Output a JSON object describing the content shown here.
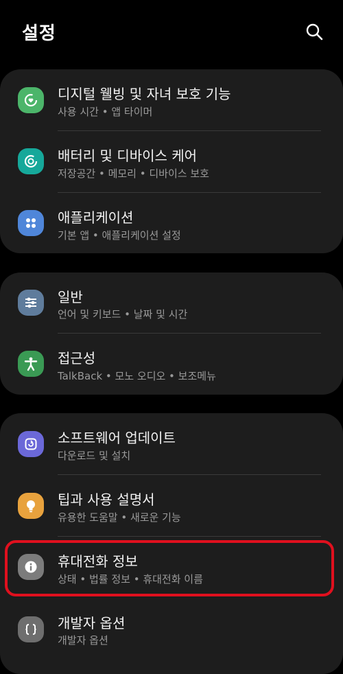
{
  "header": {
    "title": "설정",
    "search_icon": "search-icon"
  },
  "groups": [
    {
      "items": [
        {
          "title": "디지털 웰빙 및 자녀 보호 기능",
          "subtitle": "사용 시간 • 앱 타이머",
          "icon": "digital-wellbeing-icon",
          "color": "#4cb56a"
        },
        {
          "title": "배터리 및 디바이스 케어",
          "subtitle": "저장공간 • 메모리 • 디바이스 보호",
          "icon": "device-care-icon",
          "color": "#16a89a"
        },
        {
          "title": "애플리케이션",
          "subtitle": "기본 앱 • 애플리케이션 설정",
          "icon": "apps-icon",
          "color": "#4f86d9"
        }
      ]
    },
    {
      "items": [
        {
          "title": "일반",
          "subtitle": "언어 및 키보드 • 날짜 및 시간",
          "icon": "general-sliders-icon",
          "color": "#5f7c9c"
        },
        {
          "title": "접근성",
          "subtitle": "TalkBack • 모노 오디오 • 보조메뉴",
          "icon": "accessibility-icon",
          "color": "#3a9a54"
        }
      ]
    },
    {
      "items": [
        {
          "title": "소프트웨어 업데이트",
          "subtitle": "다운로드 및 설치",
          "icon": "software-update-icon",
          "color": "#6b68d8"
        },
        {
          "title": "팁과 사용 설명서",
          "subtitle": "유용한 도움말 • 새로운 기능",
          "icon": "tips-bulb-icon",
          "color": "#e8a23d"
        },
        {
          "title": "휴대전화 정보",
          "subtitle": "상태 • 법률 정보 • 휴대전화 이름",
          "icon": "info-icon",
          "color": "#7c7c7c"
        },
        {
          "title": "개발자 옵션",
          "subtitle": "개발자 옵션",
          "icon": "developer-braces-icon",
          "color": "#6e6e6e"
        }
      ]
    }
  ],
  "colors": {
    "background": "#000000",
    "card": "#1d1d1d",
    "highlight": "#e0101e",
    "subtitle": "#9a9a9a"
  }
}
